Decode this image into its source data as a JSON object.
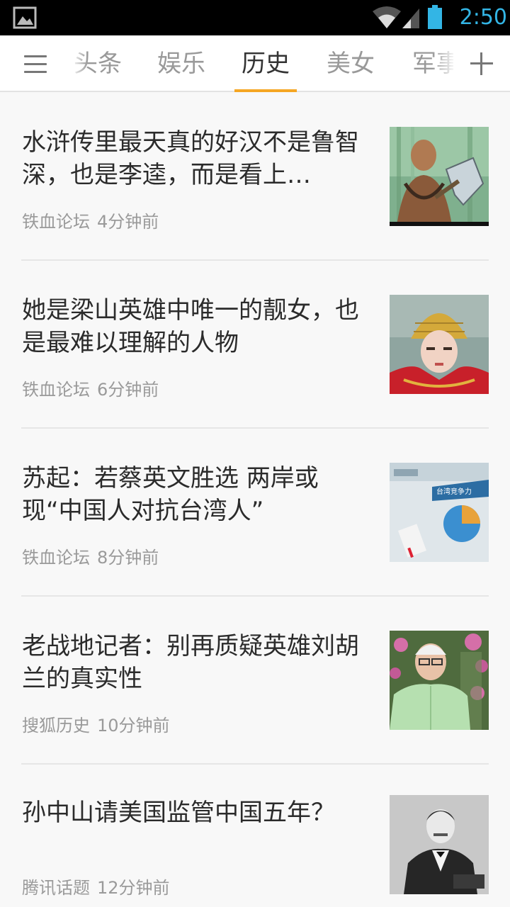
{
  "status_bar": {
    "time": "2:50",
    "icons": [
      "gallery-icon",
      "wifi-icon",
      "signal-icon",
      "battery-icon"
    ],
    "time_color": "#33b5e5"
  },
  "tabbar": {
    "menu_icon": "menu-icon",
    "tabs": [
      {
        "label": "头条",
        "active": false
      },
      {
        "label": "娱乐",
        "active": false
      },
      {
        "label": "历史",
        "active": true
      },
      {
        "label": "美女",
        "active": false
      },
      {
        "label": "军事",
        "active": false
      }
    ],
    "add_icon": "plus-icon",
    "indicator_color": "#f5a623"
  },
  "articles": [
    {
      "title": "水浒传里最天真的好汉不是鲁智深，也是李逵，而是看上…",
      "source": "铁血论坛",
      "time": "4分钟前",
      "thumbnail": "warrior-with-axe-thumbnail"
    },
    {
      "title": "她是梁山英雄中唯一的靓女，也是最难以理解的人物",
      "source": "铁血论坛",
      "time": "6分钟前",
      "thumbnail": "female-warrior-helmet-thumbnail"
    },
    {
      "title": "苏起：若蔡英文胜选 两岸或现“中国人对抗台湾人”",
      "source": "铁血论坛",
      "time": "8分钟前",
      "thumbnail": "tv-news-pie-chart-thumbnail",
      "thumb_caption": "台湾竞争力"
    },
    {
      "title": "老战地记者：别再质疑英雄刘胡兰的真实性",
      "source": "搜狐历史",
      "time": "10分钟前",
      "thumbnail": "elderly-man-flowers-thumbnail"
    },
    {
      "title": "孙中山请美国监管中国五年？",
      "source": "腾讯话题",
      "time": "12分钟前",
      "thumbnail": "vintage-portrait-thumbnail"
    }
  ]
}
